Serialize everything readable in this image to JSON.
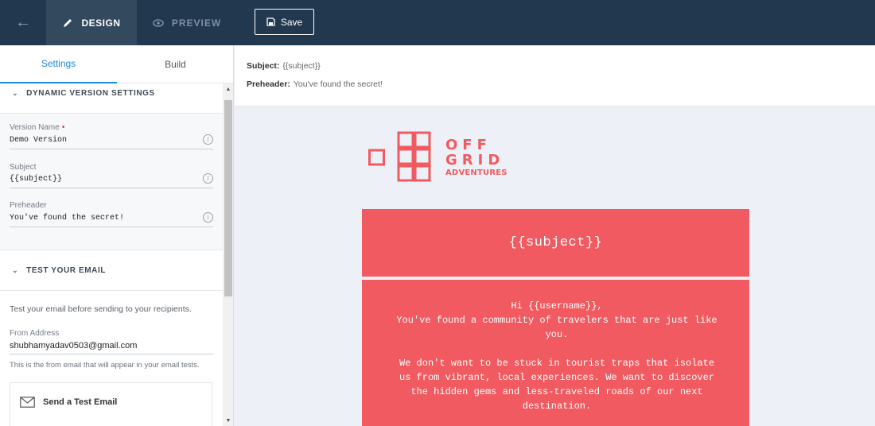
{
  "topbar": {
    "back_label": "←",
    "design_label": "DESIGN",
    "preview_label": "PREVIEW",
    "save_label": "Save"
  },
  "left": {
    "tabs": [
      "Settings",
      "Build"
    ],
    "dynamic_section_title": "DYNAMIC VERSION SETTINGS",
    "version_name_label": "Version Name",
    "required_mark": "•",
    "version_name_value": "Demo Version",
    "subject_label": "Subject",
    "subject_value": "{{subject}}",
    "preheader_label": "Preheader",
    "preheader_value": "You've found the secret!",
    "info_glyph": "i",
    "test_section_title": "TEST YOUR EMAIL",
    "test_helper": "Test your email before sending to your recipients.",
    "from_label": "From Address",
    "from_value": "shubhamyadav0503@gmail.com",
    "from_help": "This is the from email that will appear in your email tests.",
    "send_label": "Send a Test Email"
  },
  "meta": {
    "subject_label": "Subject:",
    "subject_value": "{{subject}}",
    "preheader_label": "Preheader:",
    "preheader_value": "You've found the secret!"
  },
  "email": {
    "logo_line1": "OFF",
    "logo_line2": "GRID",
    "logo_line3": "ADVENTURES",
    "subject_heading": "{{subject}}",
    "body": "Hi {{username}},\nYou've found a community of travelers that are just like you.\n\nWe don't want to be stuck in tourist traps that isolate us from vibrant, local experiences. We want to discover the hidden gems and less-traveled roads of our next destination."
  },
  "colors": {
    "topbar": "#21384f",
    "accent_blue": "#1f8ad8",
    "brand_coral": "#f15a60"
  }
}
